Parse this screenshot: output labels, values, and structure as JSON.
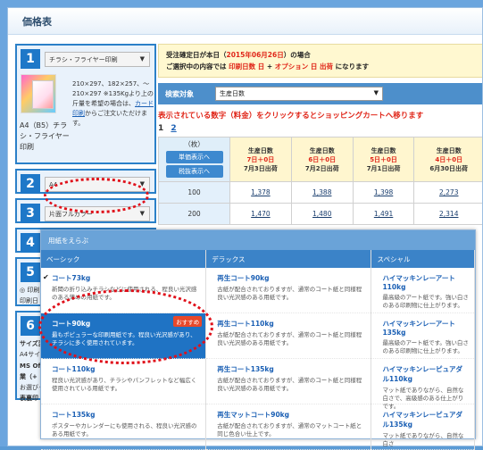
{
  "page": {
    "title": "価格表"
  },
  "steps": [
    {
      "num": "1",
      "select": "チラシ・フライヤー印刷",
      "size_label": "A4（B5）チラシ・フライヤー印刷",
      "desc_pre": "210×297、182×257、～210×297 ※135Kgより上の斤量を希望の場合は、",
      "desc_link": "カード印刷",
      "desc_post": "からご注文いただけます。"
    },
    {
      "num": "2",
      "select": "A4"
    },
    {
      "num": "3",
      "select": "片面フルカラー"
    },
    {
      "num": "4",
      "select": ""
    },
    {
      "num": "5",
      "radio": "◎ 印刷日",
      "sub": "印刷日"
    },
    {
      "num": "6",
      "line1": "サイズ変",
      "line2": "A4サイ",
      "line3": "MS Offi",
      "line4": "業（+",
      "line5": "お選びく",
      "line6": "表裏印"
    }
  ],
  "notice": {
    "line1_pre": "受注確定日が本日（",
    "line1_date": "2015年06月26日",
    "line1_post": "）の場合",
    "line2_pre": "ご選択中の内容では ",
    "line2_day": "印刷日数 日",
    "line2_mid": " + ",
    "line2_opt": "オプション 日 出荷",
    "line2_post": " になります"
  },
  "search": {
    "label": "検索対象",
    "value": "生産日数"
  },
  "click_tip": "表示されている数字（料金）をクリックするとショッピングカートへ移ります",
  "pager": {
    "current": "1",
    "next": "2"
  },
  "table": {
    "unit_label": "（枚）",
    "btn_unit": "単価表示へ",
    "btn_tax": "税抜表示へ",
    "columns": [
      {
        "l1": "生産日数",
        "l2": "7日＋0日",
        "l3": "7月3日出荷"
      },
      {
        "l1": "生産日数",
        "l2": "6日＋0日",
        "l3": "7月2日出荷"
      },
      {
        "l1": "生産日数",
        "l2": "5日＋0日",
        "l3": "7月1日出荷"
      },
      {
        "l1": "生産日数",
        "l2": "4日＋0日",
        "l3": "6月30日出荷"
      }
    ],
    "rows": [
      {
        "qty": "100",
        "prices": [
          "1,378",
          "1,388",
          "1,398",
          "2,273"
        ]
      },
      {
        "qty": "200",
        "prices": [
          "1,470",
          "1,480",
          "1,491",
          "2,314"
        ]
      }
    ]
  },
  "popup": {
    "title": "用紙をえらぶ",
    "columns": [
      {
        "header": "ベーシック",
        "items": [
          {
            "name": "コート73kg",
            "desc": "新聞の折り込みチラシなどに使用される、程良い光沢感のある薄めの用紙です。",
            "checked": true
          },
          {
            "name": "コート90kg",
            "desc": "最もポピュラーな印刷用紙です。程良い光沢感があり、チラシに多く使用されています。",
            "selected": true,
            "badge": "おすすめ"
          },
          {
            "name": "コート110kg",
            "desc": "程良い光沢感があり、チラシやパンフレットなど幅広く使用されている用紙です。"
          },
          {
            "name": "コート135kg",
            "desc": "ポスターやカレンダーにも使用される、程良い光沢感のある用紙です。"
          }
        ]
      },
      {
        "header": "デラックス",
        "items": [
          {
            "name": "再生コート90kg",
            "desc": "古紙が配合されておりますが、通常のコート紙と同様程良い光沢感のある用紙です。"
          },
          {
            "name": "再生コート110kg",
            "desc": "古紙が配合されておりますが、通常のコート紙と同様程良い光沢感のある用紙です。"
          },
          {
            "name": "再生コート135kg",
            "desc": "古紙が配合されておりますが、通常のコート紙と同様程良い光沢感のある用紙です。"
          },
          {
            "name": "再生マットコート90kg",
            "desc": "古紙が配合されておりますが、通常のマットコート紙と同じ色合い仕上です。"
          }
        ]
      },
      {
        "header": "スペシャル",
        "items": [
          {
            "name": "ハイマッキンレーアート110kg",
            "desc": "最高級のアート紙です。強い白さのある印刷物に仕上がります。"
          },
          {
            "name": "ハイマッキンレーアート135kg",
            "desc": "最高級のアート紙です。強い白さのある印刷物に仕上がります。"
          },
          {
            "name": "ハイマッキンレーピュアダル110kg",
            "desc": "マット紙でありながら、自然な白さで、高級感のある仕上がりです。"
          },
          {
            "name": "ハイマッキンレーピュアダル135kg",
            "desc": "マット紙でありながら、自然な白さ"
          }
        ]
      }
    ]
  },
  "colors": {
    "accent": "#1e78c8",
    "red": "#e0271a",
    "header_blue": "#4d8fcb"
  }
}
